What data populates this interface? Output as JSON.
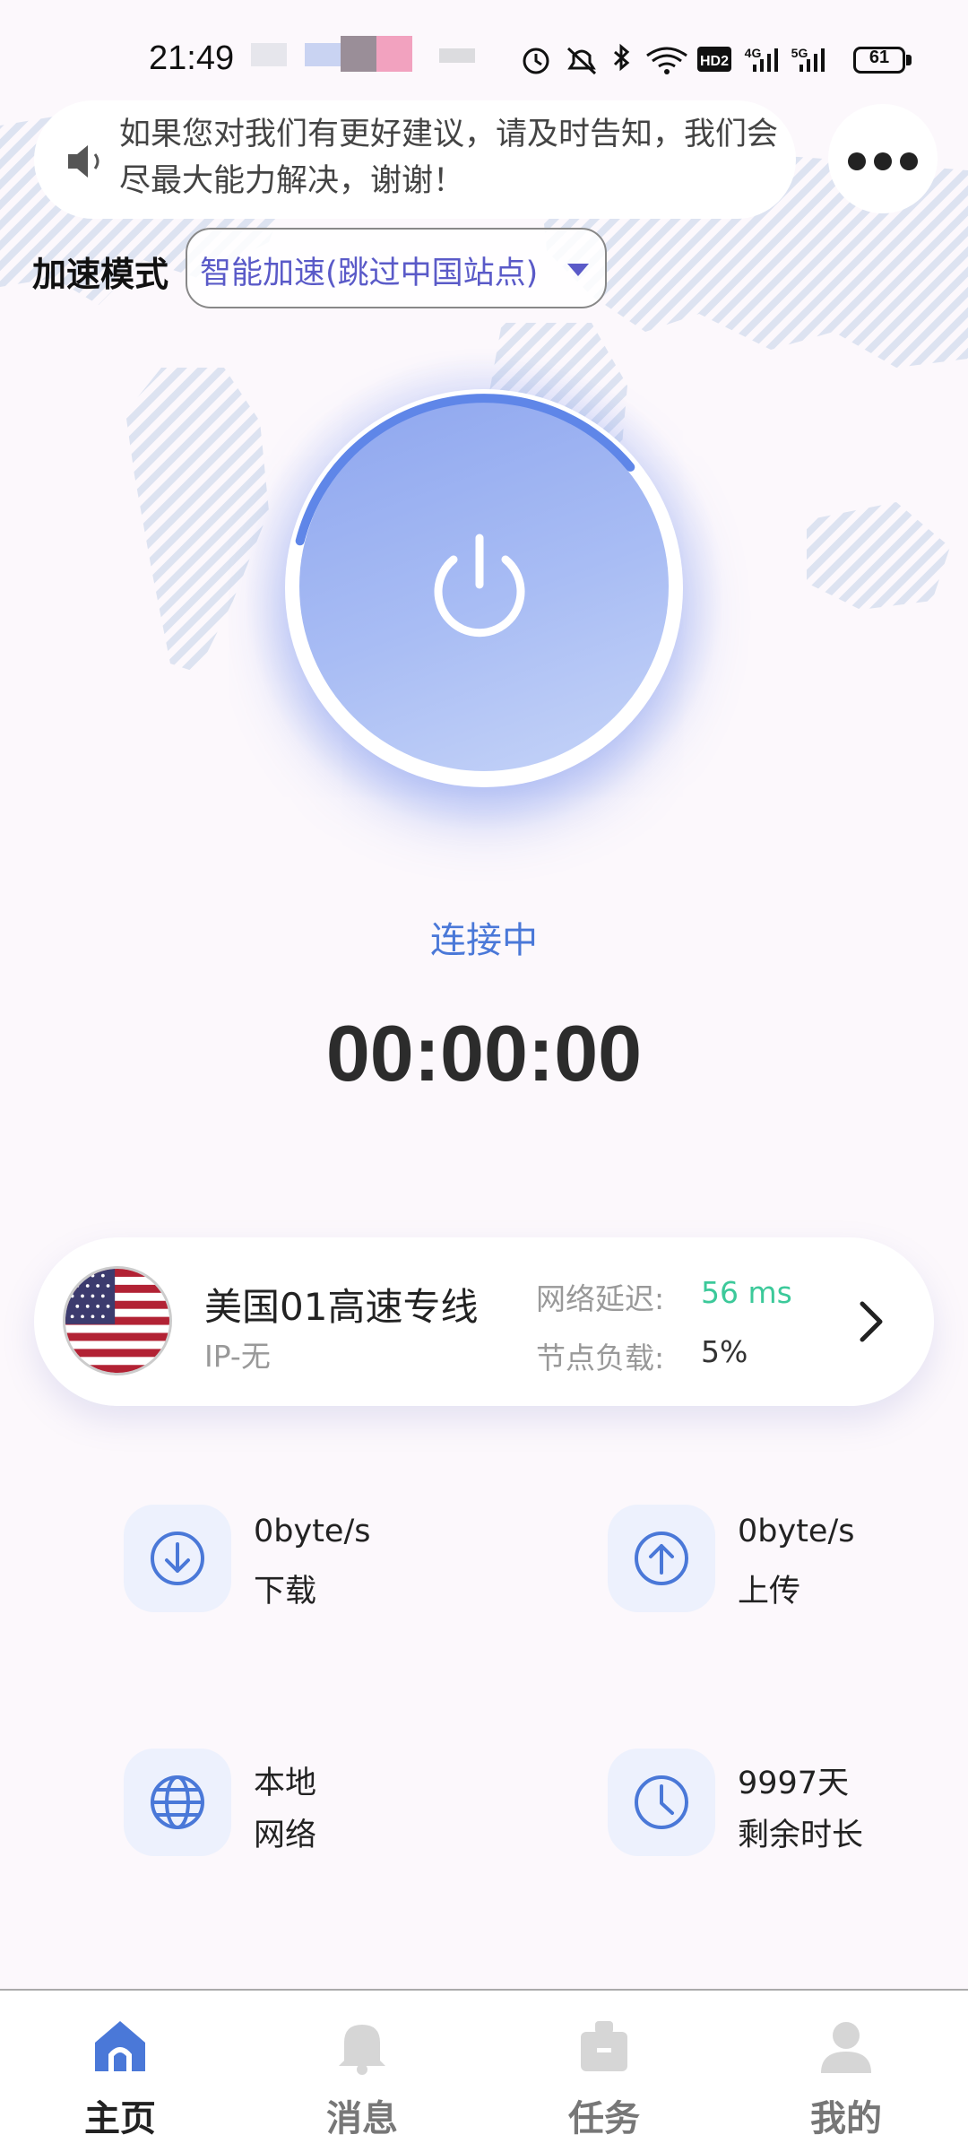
{
  "status_bar": {
    "time": "21:49",
    "battery": "61",
    "network_labels": [
      "HD2",
      "4G",
      "5G"
    ]
  },
  "notice": {
    "text": "如果您对我们有更好建议，请及时告知，我们会尽最大能力解决，谢谢！"
  },
  "mode": {
    "label": "加速模式",
    "selected": "智能加速(跳过中国站点)"
  },
  "connection": {
    "status": "连接中",
    "timer": "00:00:00",
    "progress_arc": 0.35
  },
  "server": {
    "name": "美国01高速专线",
    "ip": "IP-无",
    "latency_label": "网络延迟:",
    "latency_value": "56 ms",
    "load_label": "节点负载:",
    "load_value": "5%"
  },
  "stats": {
    "download_value": "0byte/s",
    "download_label": "下载",
    "upload_value": "0byte/s",
    "upload_label": "上传",
    "network_value": "本地",
    "network_label": "网络",
    "remaining_value": "9997天",
    "remaining_label": "剩余时长"
  },
  "nav": {
    "home": "主页",
    "messages": "消息",
    "tasks": "任务",
    "profile": "我的",
    "active": "home"
  },
  "colors": {
    "accent": "#4a78d8",
    "latency": "#3cc99a",
    "mode_text": "#5a5ac8",
    "nav_inactive": "#777777",
    "nav_active": "#222222"
  }
}
